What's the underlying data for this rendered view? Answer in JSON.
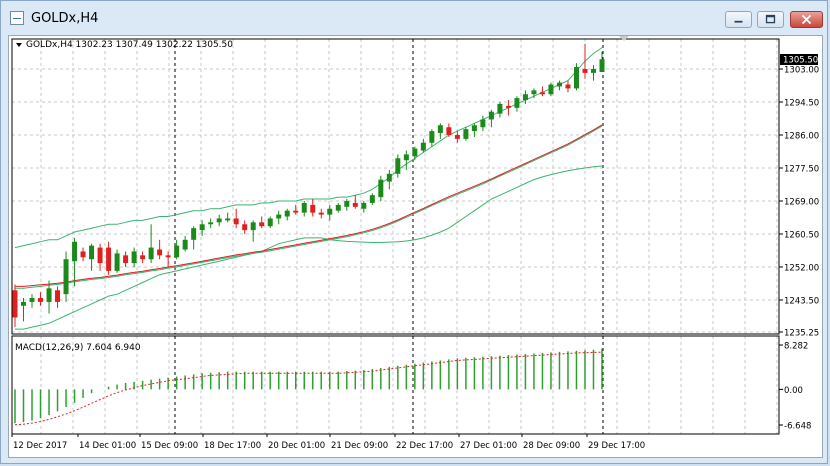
{
  "window": {
    "title": "GOLDx,H4",
    "icons": [
      "chart-window-icon",
      "minimize-icon",
      "maximize-icon",
      "close-icon"
    ]
  },
  "chart": {
    "header_text": "GOLDx,H4  1302.23 1307.49 1302.22 1305.50",
    "price_label": "1305.50",
    "macd_label": "MACD(12,26,9) 7.604 6.940"
  },
  "colors": {
    "bull_candle": "#1b8a1b",
    "bear_candle": "#e02020",
    "bollinger_band": "#3cb371",
    "moving_average": "#e02020",
    "macd_histogram": "#2ea02e",
    "macd_signal": "#e02020",
    "grid": "#c8c8c8"
  },
  "chart_data": [
    {
      "type": "candlestick",
      "title": "GOLDx,H4",
      "ohlc": [
        [
          1246.0,
          1247.5,
          1236.5,
          1239.0
        ],
        [
          1242.0,
          1244.0,
          1238.0,
          1243.0
        ],
        [
          1243.0,
          1245.0,
          1241.5,
          1244.0
        ],
        [
          1244.0,
          1245.5,
          1242.0,
          1243.0
        ],
        [
          1243.0,
          1248.5,
          1240.0,
          1246.5
        ],
        [
          1246.0,
          1247.0,
          1241.5,
          1243.0
        ],
        [
          1245.0,
          1256.0,
          1243.0,
          1254.0
        ],
        [
          1253.5,
          1259.5,
          1247.0,
          1258.5
        ],
        [
          1256.0,
          1257.0,
          1253.5,
          1254.5
        ],
        [
          1254.0,
          1258.0,
          1251.0,
          1257.5
        ],
        [
          1257.0,
          1258.0,
          1251.0,
          1253.0
        ],
        [
          1257.0,
          1258.5,
          1250.0,
          1251.0
        ],
        [
          1251.0,
          1256.5,
          1250.5,
          1255.5
        ],
        [
          1255.0,
          1256.0,
          1252.0,
          1253.0
        ],
        [
          1253.0,
          1257.0,
          1252.0,
          1256.0
        ],
        [
          1255.0,
          1256.0,
          1253.0,
          1254.0
        ],
        [
          1254.0,
          1263.0,
          1253.0,
          1257.0
        ],
        [
          1256.5,
          1259.0,
          1254.0,
          1255.0
        ],
        [
          1255.0,
          1256.0,
          1252.0,
          1254.5
        ],
        [
          1254.5,
          1259.0,
          1254.0,
          1257.5
        ],
        [
          1256.5,
          1260.0,
          1256.0,
          1259.0
        ],
        [
          1259.0,
          1262.5,
          1256.5,
          1262.0
        ],
        [
          1261.5,
          1264.0,
          1260.0,
          1263.0
        ],
        [
          1263.0,
          1264.5,
          1262.0,
          1263.5
        ],
        [
          1263.5,
          1265.5,
          1262.5,
          1264.5
        ],
        [
          1264.0,
          1266.0,
          1263.5,
          1264.5
        ],
        [
          1264.5,
          1267.0,
          1262.0,
          1263.0
        ],
        [
          1263.0,
          1264.0,
          1260.5,
          1261.5
        ],
        [
          1261.5,
          1264.0,
          1258.5,
          1263.5
        ],
        [
          1263.5,
          1265.0,
          1262.0,
          1262.5
        ],
        [
          1262.5,
          1265.0,
          1262.0,
          1264.5
        ],
        [
          1264.5,
          1266.5,
          1263.0,
          1265.5
        ],
        [
          1265.0,
          1267.0,
          1264.0,
          1266.5
        ],
        [
          1266.5,
          1268.0,
          1265.5,
          1266.0
        ],
        [
          1266.0,
          1269.0,
          1265.0,
          1268.5
        ],
        [
          1268.0,
          1269.5,
          1265.0,
          1266.0
        ],
        [
          1266.0,
          1267.0,
          1264.5,
          1265.5
        ],
        [
          1265.5,
          1268.0,
          1264.0,
          1267.0
        ],
        [
          1266.5,
          1268.5,
          1266.0,
          1268.0
        ],
        [
          1267.5,
          1269.5,
          1266.5,
          1269.0
        ],
        [
          1268.5,
          1270.5,
          1267.0,
          1267.5
        ],
        [
          1267.0,
          1269.0,
          1266.0,
          1268.5
        ],
        [
          1268.5,
          1271.0,
          1268.0,
          1270.5
        ],
        [
          1270.0,
          1275.5,
          1269.0,
          1274.5
        ],
        [
          1274.0,
          1277.0,
          1272.0,
          1276.0
        ],
        [
          1276.0,
          1281.0,
          1275.0,
          1280.0
        ],
        [
          1279.5,
          1282.0,
          1277.0,
          1281.0
        ],
        [
          1280.5,
          1283.0,
          1279.5,
          1282.5
        ],
        [
          1282.0,
          1285.0,
          1281.5,
          1284.0
        ],
        [
          1284.0,
          1287.5,
          1283.0,
          1287.0
        ],
        [
          1286.5,
          1289.0,
          1285.0,
          1288.5
        ],
        [
          1288.0,
          1289.0,
          1285.5,
          1286.0
        ],
        [
          1286.0,
          1287.0,
          1284.0,
          1285.0
        ],
        [
          1285.0,
          1288.0,
          1284.5,
          1287.5
        ],
        [
          1287.0,
          1289.0,
          1285.5,
          1288.5
        ],
        [
          1288.0,
          1291.0,
          1287.0,
          1290.0
        ],
        [
          1290.0,
          1292.5,
          1288.0,
          1292.0
        ],
        [
          1291.5,
          1294.5,
          1290.5,
          1294.0
        ],
        [
          1293.5,
          1295.0,
          1291.0,
          1293.0
        ],
        [
          1293.0,
          1296.0,
          1292.0,
          1295.5
        ],
        [
          1295.0,
          1297.5,
          1294.0,
          1296.5
        ],
        [
          1296.5,
          1298.0,
          1295.5,
          1297.5
        ],
        [
          1297.0,
          1298.5,
          1296.0,
          1296.5
        ],
        [
          1296.5,
          1299.5,
          1296.0,
          1299.0
        ],
        [
          1298.5,
          1300.0,
          1297.5,
          1299.5
        ],
        [
          1299.0,
          1300.0,
          1297.0,
          1298.0
        ],
        [
          1298.0,
          1304.5,
          1297.5,
          1303.5
        ],
        [
          1303.0,
          1309.5,
          1300.5,
          1302.0
        ],
        [
          1302.0,
          1304.0,
          1300.0,
          1303.0
        ],
        [
          1302.23,
          1307.49,
          1302.22,
          1305.5
        ]
      ],
      "bollinger_upper": [
        1257.0,
        1257.5,
        1258.0,
        1258.5,
        1259.0,
        1259.0,
        1260.0,
        1261.0,
        1261.5,
        1262.0,
        1262.5,
        1263.0,
        1263.0,
        1263.5,
        1264.0,
        1264.0,
        1264.5,
        1265.0,
        1265.0,
        1265.5,
        1266.0,
        1266.5,
        1266.5,
        1267.0,
        1267.0,
        1267.5,
        1268.0,
        1268.0,
        1268.0,
        1268.5,
        1268.5,
        1269.0,
        1269.0,
        1269.0,
        1269.5,
        1269.5,
        1269.5,
        1269.5,
        1270.0,
        1270.0,
        1270.5,
        1271.0,
        1272.0,
        1273.5,
        1275.0,
        1277.0,
        1278.5,
        1280.0,
        1281.5,
        1283.0,
        1284.5,
        1286.0,
        1287.0,
        1288.0,
        1289.0,
        1290.0,
        1291.0,
        1292.0,
        1293.0,
        1294.0,
        1295.0,
        1296.0,
        1297.0,
        1298.0,
        1299.0,
        1300.0,
        1302.5,
        1305.0,
        1307.0,
        1308.5
      ],
      "bollinger_middle": [
        1246.5,
        1246.5,
        1246.8,
        1247.0,
        1247.3,
        1247.5,
        1247.8,
        1248.2,
        1248.5,
        1248.8,
        1249.0,
        1249.3,
        1249.6,
        1250.0,
        1250.3,
        1250.6,
        1251.0,
        1251.3,
        1251.7,
        1252.0,
        1252.4,
        1252.8,
        1253.2,
        1253.6,
        1254.0,
        1254.4,
        1254.8,
        1255.1,
        1255.5,
        1255.8,
        1256.2,
        1256.6,
        1257.0,
        1257.4,
        1257.8,
        1258.2,
        1258.6,
        1259.0,
        1259.4,
        1259.8,
        1260.3,
        1260.8,
        1261.4,
        1262.1,
        1262.9,
        1263.8,
        1264.8,
        1265.8,
        1266.8,
        1267.8,
        1268.8,
        1269.8,
        1270.7,
        1271.6,
        1272.5,
        1273.4,
        1274.4,
        1275.4,
        1276.4,
        1277.4,
        1278.4,
        1279.4,
        1280.4,
        1281.4,
        1282.4,
        1283.4,
        1284.6,
        1285.8,
        1287.0,
        1288.3
      ],
      "moving_average": [
        1247.0,
        1247.0,
        1247.2,
        1247.4,
        1247.6,
        1247.8,
        1248.1,
        1248.5,
        1248.8,
        1249.1,
        1249.3,
        1249.6,
        1249.9,
        1250.3,
        1250.6,
        1250.9,
        1251.3,
        1251.6,
        1252.0,
        1252.3,
        1252.7,
        1253.1,
        1253.5,
        1253.9,
        1254.3,
        1254.7,
        1255.1,
        1255.4,
        1255.8,
        1256.1,
        1256.5,
        1256.9,
        1257.3,
        1257.7,
        1258.1,
        1258.5,
        1258.9,
        1259.3,
        1259.7,
        1260.1,
        1260.6,
        1261.1,
        1261.7,
        1262.4,
        1263.2,
        1264.1,
        1265.1,
        1266.1,
        1267.1,
        1268.1,
        1269.1,
        1270.1,
        1271.0,
        1271.9,
        1272.8,
        1273.7,
        1274.7,
        1275.7,
        1276.7,
        1277.7,
        1278.7,
        1279.7,
        1280.7,
        1281.7,
        1282.7,
        1283.7,
        1284.9,
        1286.1,
        1287.3,
        1288.6
      ],
      "bollinger_lower": [
        1236.0,
        1236.0,
        1236.5,
        1237.0,
        1237.5,
        1238.5,
        1239.5,
        1240.5,
        1241.5,
        1242.5,
        1243.5,
        1244.5,
        1245.0,
        1246.0,
        1247.0,
        1248.0,
        1249.0,
        1250.0,
        1250.5,
        1251.0,
        1251.5,
        1252.0,
        1252.5,
        1253.0,
        1253.5,
        1254.0,
        1254.5,
        1255.0,
        1255.5,
        1256.0,
        1257.0,
        1258.0,
        1258.5,
        1259.0,
        1259.5,
        1259.5,
        1259.5,
        1259.0,
        1258.8,
        1258.6,
        1258.5,
        1258.4,
        1258.3,
        1258.3,
        1258.4,
        1258.5,
        1258.7,
        1259.0,
        1259.5,
        1260.2,
        1261.0,
        1262.0,
        1263.5,
        1265.0,
        1266.5,
        1268.0,
        1269.5,
        1270.5,
        1271.5,
        1272.5,
        1273.5,
        1274.5,
        1275.2,
        1275.8,
        1276.3,
        1276.8,
        1277.2,
        1277.5,
        1277.8,
        1278.0
      ],
      "ylim": [
        1235.25,
        1310.0
      ],
      "y_ticks": [
        "1303.00",
        "1294.50",
        "1286.00",
        "1277.50",
        "1269.00",
        "1260.50",
        "1252.00",
        "1243.50",
        "1235.25"
      ],
      "x_labels": [
        "12 Dec 2017",
        "14 Dec 01:00",
        "15 Dec 09:00",
        "18 Dec 17:00",
        "20 Dec 01:00",
        "21 Dec 09:00",
        "22 Dec 17:00",
        "27 Dec 01:00",
        "28 Dec 09:00",
        "29 Dec 17:00"
      ],
      "grid": true
    },
    {
      "type": "bar",
      "title": "MACD(12,26,9) 7.604 6.940",
      "histogram": [
        -6.3,
        -6.1,
        -5.8,
        -5.4,
        -4.8,
        -4.1,
        -3.3,
        -2.5,
        -1.6,
        -0.7,
        0.0,
        0.5,
        0.9,
        1.2,
        1.4,
        1.6,
        1.8,
        2.0,
        2.2,
        2.4,
        2.6,
        2.8,
        3.0,
        3.1,
        3.2,
        3.3,
        3.3,
        3.3,
        3.3,
        3.3,
        3.3,
        3.3,
        3.3,
        3.3,
        3.3,
        3.3,
        3.3,
        3.3,
        3.3,
        3.4,
        3.5,
        3.6,
        3.8,
        4.0,
        4.2,
        4.4,
        4.6,
        4.8,
        5.0,
        5.2,
        5.4,
        5.6,
        5.8,
        5.9,
        6.0,
        6.1,
        6.2,
        6.3,
        6.4,
        6.5,
        6.6,
        6.7,
        6.8,
        6.9,
        7.0,
        7.1,
        7.2,
        7.3,
        7.4,
        7.604
      ],
      "signal": [
        -6.6,
        -6.5,
        -6.3,
        -6.0,
        -5.6,
        -5.1,
        -4.6,
        -4.0,
        -3.3,
        -2.6,
        -1.9,
        -1.2,
        -0.6,
        -0.1,
        0.3,
        0.7,
        1.0,
        1.3,
        1.6,
        1.8,
        2.0,
        2.2,
        2.4,
        2.6,
        2.7,
        2.8,
        2.9,
        3.0,
        3.0,
        3.0,
        3.0,
        3.0,
        3.0,
        3.0,
        3.0,
        3.0,
        3.0,
        3.0,
        3.0,
        3.1,
        3.2,
        3.3,
        3.4,
        3.6,
        3.8,
        4.0,
        4.2,
        4.4,
        4.6,
        4.8,
        5.0,
        5.2,
        5.4,
        5.5,
        5.6,
        5.7,
        5.8,
        5.9,
        6.0,
        6.1,
        6.2,
        6.3,
        6.4,
        6.5,
        6.6,
        6.7,
        6.8,
        6.85,
        6.9,
        6.94
      ],
      "ylim": [
        -6.648,
        8.282
      ],
      "y_ticks": [
        "8.282",
        "0.00",
        "-6.648"
      ]
    }
  ]
}
